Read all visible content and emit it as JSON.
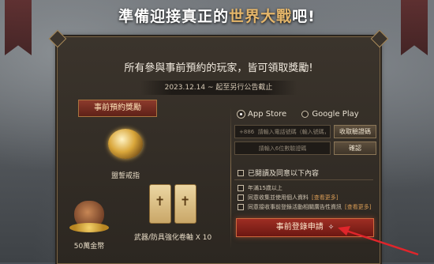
{
  "page": {
    "title_prefix": "準備迎接真正的",
    "title_highlight": "世界大戰",
    "title_suffix": "吧!"
  },
  "panel": {
    "headline": "所有參與事前預約的玩家，皆可領取獎勵!",
    "date_range": "2023.12.14 ~ 起至另行公告截止"
  },
  "rewards": {
    "ribbon": "事前預約獎勵",
    "items": [
      {
        "label": "盟誓戒指",
        "icon": "ring-icon"
      },
      {
        "label": "50萬金幣",
        "icon": "coin-pouch-icon"
      },
      {
        "label": "武器/防具強化卷軸 X 10",
        "icon": "scroll-icon"
      }
    ]
  },
  "form": {
    "platforms": [
      {
        "label": "App Store",
        "selected": true
      },
      {
        "label": "Google Play",
        "selected": false
      }
    ],
    "phone_prefix": "+886",
    "phone_placeholder": "請輸入電話號碼（輸入號碼，不含\"-\"）",
    "send_code_label": "收取驗證碼",
    "code_placeholder": "請輸入6位數驗證碼",
    "confirm_label": "確認",
    "agree_all_label": "已閱讀及同意以下內容",
    "agreements": [
      {
        "label": "年滿15歲以上",
        "more": ""
      },
      {
        "label": "同意收集並使用個人資料",
        "more": "[查看更多]"
      },
      {
        "label": "同意接收事前登錄活動相關廣告性資訊",
        "more": "[查看更多]"
      }
    ],
    "submit_label": "事前登錄申請",
    "submit_sparkle": "✧"
  },
  "colors": {
    "accent_gold": "#e5b66a",
    "submit_red": "#9e2e23",
    "annotation_arrow": "#e0252b"
  }
}
